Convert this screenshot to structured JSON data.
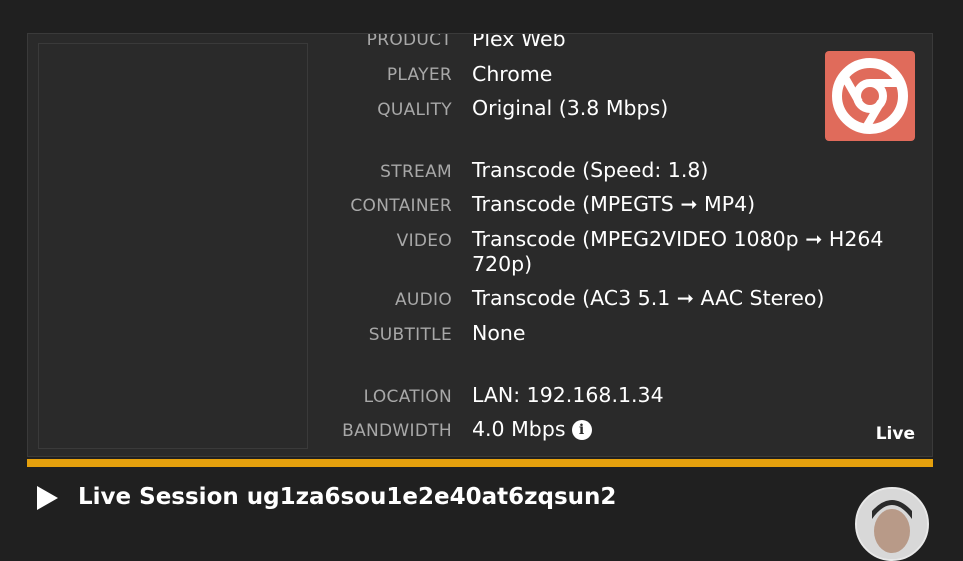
{
  "session_details": {
    "rows_top": [
      {
        "label": "PRODUCT",
        "value": "Plex Web"
      },
      {
        "label": "PLAYER",
        "value": "Chrome"
      },
      {
        "label": "QUALITY",
        "value": "Original (3.8 Mbps)"
      }
    ],
    "rows_stream": [
      {
        "label": "STREAM",
        "value": "Transcode (Speed: 1.8)"
      },
      {
        "label": "CONTAINER",
        "value": "Transcode (MPEGTS ➞ MP4)"
      },
      {
        "label": "VIDEO",
        "value": "Transcode (MPEG2VIDEO 1080p ➞ H264 720p)"
      },
      {
        "label": "AUDIO",
        "value": "Transcode (AC3 5.1 ➞ AAC Stereo)"
      },
      {
        "label": "SUBTITLE",
        "value": "None"
      }
    ],
    "rows_network": [
      {
        "label": "LOCATION",
        "value": "LAN: 192.168.1.34"
      },
      {
        "label": "BANDWIDTH",
        "value": "4.0 Mbps"
      }
    ],
    "player_icon": "chrome-icon",
    "status_badge": "Live"
  },
  "progress": {
    "fraction": 1.0,
    "color": "#e5a00d"
  },
  "session": {
    "title": "Live Session ug1za6sou1e2e40at6zqsun2",
    "play_icon": "play-icon"
  },
  "colors": {
    "accent": "#e5a00d",
    "chrome_tile": "#e06b5b"
  }
}
